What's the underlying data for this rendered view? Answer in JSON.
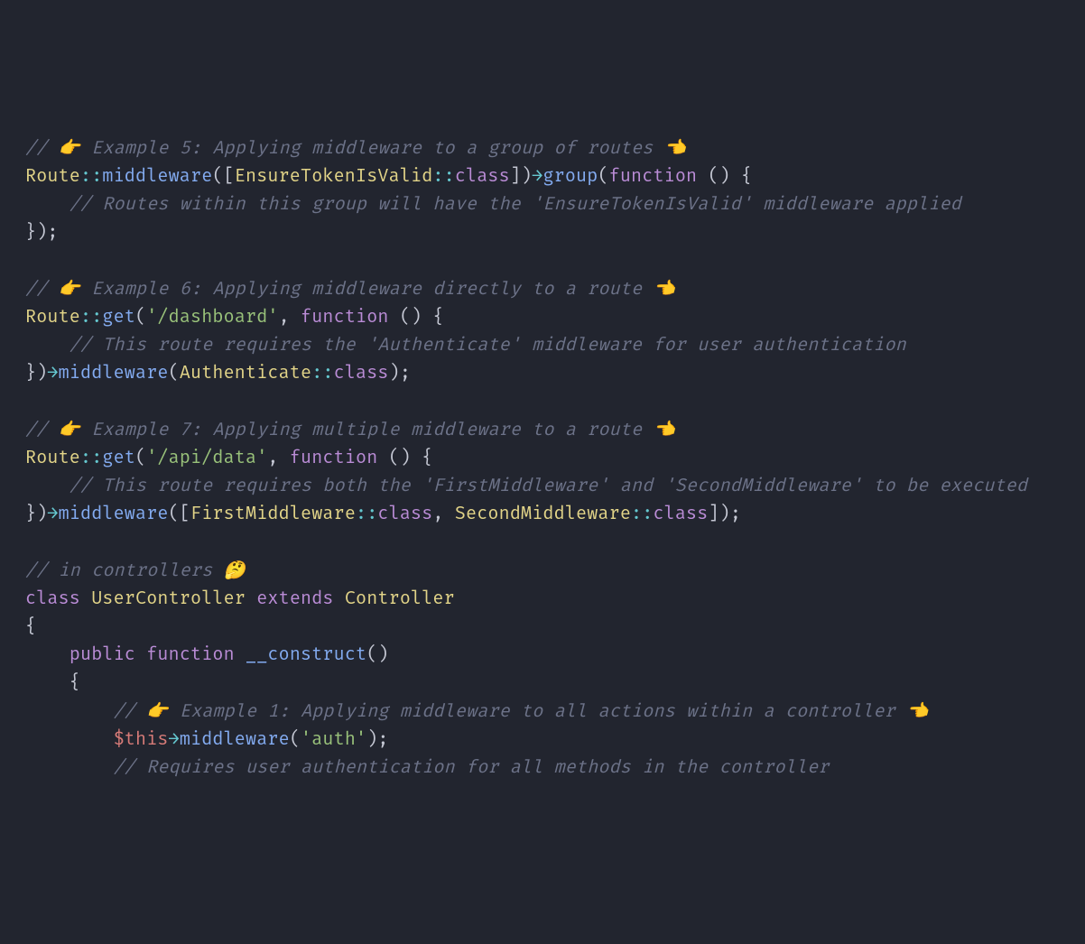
{
  "tokens": [
    {
      "c": "cm",
      "t": "// 👉 Example 5: Applying middleware to a group of routes 👈"
    },
    {
      "br": 1
    },
    {
      "c": "ty",
      "t": "Route"
    },
    {
      "c": "op",
      "t": "::"
    },
    {
      "c": "fn",
      "t": "middleware"
    },
    {
      "c": "pn",
      "t": "(["
    },
    {
      "c": "ty",
      "t": "EnsureTokenIsValid"
    },
    {
      "c": "op",
      "t": "::"
    },
    {
      "c": "kw",
      "t": "class"
    },
    {
      "c": "pn",
      "t": "])"
    },
    {
      "c": "op",
      "t": "→"
    },
    {
      "c": "fn",
      "t": "group"
    },
    {
      "c": "pn",
      "t": "("
    },
    {
      "c": "kw",
      "t": "function"
    },
    {
      "c": "pn",
      "t": " () {"
    },
    {
      "br": 1
    },
    {
      "c": "pn",
      "t": "    "
    },
    {
      "c": "cm",
      "t": "// Routes within this group will have the 'EnsureTokenIsValid' middleware applied"
    },
    {
      "br": 1
    },
    {
      "c": "pn",
      "t": "});"
    },
    {
      "br": 1
    },
    {
      "br": 1
    },
    {
      "c": "cm",
      "t": "// 👉 Example 6: Applying middleware directly to a route 👈"
    },
    {
      "br": 1
    },
    {
      "c": "ty",
      "t": "Route"
    },
    {
      "c": "op",
      "t": "::"
    },
    {
      "c": "fn",
      "t": "get"
    },
    {
      "c": "pn",
      "t": "("
    },
    {
      "c": "st",
      "t": "'/dashboard'"
    },
    {
      "c": "pn",
      "t": ", "
    },
    {
      "c": "kw",
      "t": "function"
    },
    {
      "c": "pn",
      "t": " () {"
    },
    {
      "br": 1
    },
    {
      "c": "pn",
      "t": "    "
    },
    {
      "c": "cm",
      "t": "// This route requires the 'Authenticate' middleware for user authentication"
    },
    {
      "br": 1
    },
    {
      "c": "pn",
      "t": "})"
    },
    {
      "c": "op",
      "t": "→"
    },
    {
      "c": "fn",
      "t": "middleware"
    },
    {
      "c": "pn",
      "t": "("
    },
    {
      "c": "ty",
      "t": "Authenticate"
    },
    {
      "c": "op",
      "t": "::"
    },
    {
      "c": "kw",
      "t": "class"
    },
    {
      "c": "pn",
      "t": ");"
    },
    {
      "br": 1
    },
    {
      "br": 1
    },
    {
      "c": "cm",
      "t": "// 👉 Example 7: Applying multiple middleware to a route 👈"
    },
    {
      "br": 1
    },
    {
      "c": "ty",
      "t": "Route"
    },
    {
      "c": "op",
      "t": "::"
    },
    {
      "c": "fn",
      "t": "get"
    },
    {
      "c": "pn",
      "t": "("
    },
    {
      "c": "st",
      "t": "'/api/data'"
    },
    {
      "c": "pn",
      "t": ", "
    },
    {
      "c": "kw",
      "t": "function"
    },
    {
      "c": "pn",
      "t": " () {"
    },
    {
      "br": 1
    },
    {
      "c": "pn",
      "t": "    "
    },
    {
      "c": "cm",
      "t": "// This route requires both the 'FirstMiddleware' and 'SecondMiddleware' to be executed"
    },
    {
      "br": 1
    },
    {
      "c": "pn",
      "t": "})"
    },
    {
      "c": "op",
      "t": "→"
    },
    {
      "c": "fn",
      "t": "middleware"
    },
    {
      "c": "pn",
      "t": "(["
    },
    {
      "c": "ty",
      "t": "FirstMiddleware"
    },
    {
      "c": "op",
      "t": "::"
    },
    {
      "c": "kw",
      "t": "class"
    },
    {
      "c": "pn",
      "t": ", "
    },
    {
      "c": "ty",
      "t": "SecondMiddleware"
    },
    {
      "c": "op",
      "t": "::"
    },
    {
      "c": "kw",
      "t": "class"
    },
    {
      "c": "pn",
      "t": "]);"
    },
    {
      "br": 1
    },
    {
      "br": 1
    },
    {
      "c": "cm",
      "t": "// in controllers 🤔"
    },
    {
      "br": 1
    },
    {
      "c": "kw",
      "t": "class"
    },
    {
      "c": "pn",
      "t": " "
    },
    {
      "c": "ty",
      "t": "UserController"
    },
    {
      "c": "pn",
      "t": " "
    },
    {
      "c": "kw",
      "t": "extends"
    },
    {
      "c": "pn",
      "t": " "
    },
    {
      "c": "ty",
      "t": "Controller"
    },
    {
      "br": 1
    },
    {
      "c": "pn",
      "t": "{"
    },
    {
      "br": 1
    },
    {
      "c": "pn",
      "t": "    "
    },
    {
      "c": "kw",
      "t": "public"
    },
    {
      "c": "pn",
      "t": " "
    },
    {
      "c": "kw",
      "t": "function"
    },
    {
      "c": "pn",
      "t": " "
    },
    {
      "c": "fn",
      "t": "__construct"
    },
    {
      "c": "pn",
      "t": "()"
    },
    {
      "br": 1
    },
    {
      "c": "pn",
      "t": "    {"
    },
    {
      "br": 1
    },
    {
      "c": "pn",
      "t": "        "
    },
    {
      "c": "cm",
      "t": "// 👉 Example 1: Applying middleware to all actions within a controller 👈"
    },
    {
      "br": 1
    },
    {
      "c": "pn",
      "t": "        "
    },
    {
      "c": "va",
      "t": "$this"
    },
    {
      "c": "op",
      "t": "→"
    },
    {
      "c": "fn",
      "t": "middleware"
    },
    {
      "c": "pn",
      "t": "("
    },
    {
      "c": "st",
      "t": "'auth'"
    },
    {
      "c": "pn",
      "t": ");"
    },
    {
      "br": 1
    },
    {
      "c": "pn",
      "t": "        "
    },
    {
      "c": "cm",
      "t": "// Requires user authentication for all methods in the controller"
    }
  ]
}
